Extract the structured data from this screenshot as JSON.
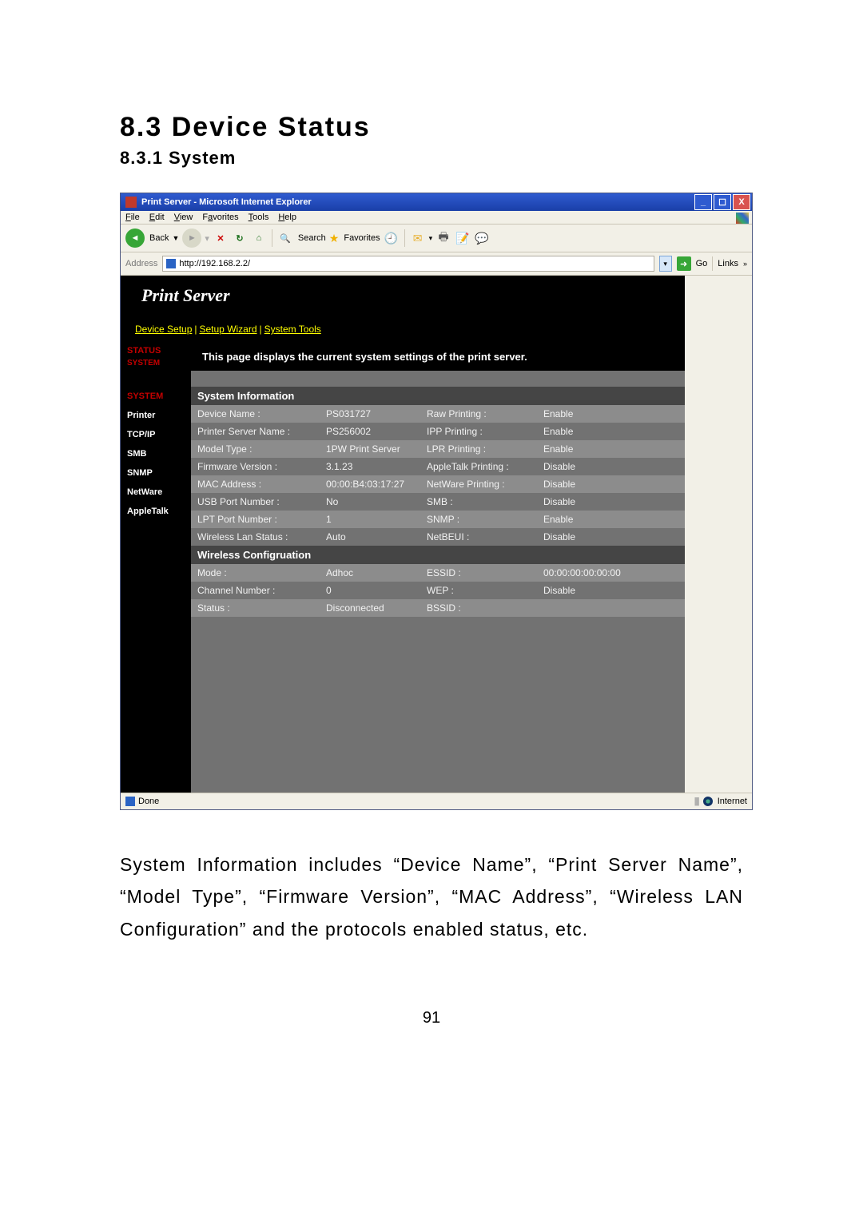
{
  "doc": {
    "h1": "8.3   Device Status",
    "h2": "8.3.1   System",
    "caption": "System Information includes “Device Name”, “Print Server Name”, “Model Type”, “Firmware Version”, “MAC Address”, “Wireless LAN Configuration” and the protocols enabled status, etc.",
    "page_number": "91"
  },
  "browser": {
    "title": "Print Server - Microsoft Internet Explorer",
    "menus": {
      "file": "File",
      "edit": "Edit",
      "view": "View",
      "favorites": "Favorites",
      "tools": "Tools",
      "help": "Help"
    },
    "toolbar": {
      "back": "Back",
      "search": "Search",
      "favorites": "Favorites"
    },
    "address_label": "Address",
    "address_url": "http://192.168.2.2/",
    "go_label": "Go",
    "links_label": "Links",
    "status_done": "Done",
    "status_zone": "Internet"
  },
  "page": {
    "header": "Print Server",
    "nav": {
      "setup": "Device Setup",
      "wizard": "Setup Wizard",
      "tools": "System Tools"
    },
    "sidebar": {
      "status": "STATUS",
      "system_sub": "SYSTEM",
      "items": [
        "SYSTEM",
        "Printer",
        "TCP/IP",
        "SMB",
        "SNMP",
        "NetWare",
        "AppleTalk"
      ]
    },
    "desc": "This page displays the current system settings of the print server.",
    "sections": {
      "sys_info": "System Information",
      "wireless": "Wireless Configruation"
    },
    "sys_rows": [
      {
        "l1": "Device Name :",
        "v1": "PS031727",
        "l2": "Raw Printing :",
        "v2": "Enable"
      },
      {
        "l1": "Printer Server Name :",
        "v1": "PS256002",
        "l2": "IPP Printing :",
        "v2": "Enable"
      },
      {
        "l1": "Model Type :",
        "v1": "1PW Print Server",
        "l2": "LPR Printing :",
        "v2": "Enable"
      },
      {
        "l1": "Firmware Version :",
        "v1": "3.1.23",
        "l2": "AppleTalk Printing :",
        "v2": "Disable"
      },
      {
        "l1": "MAC Address :",
        "v1": "00:00:B4:03:17:27",
        "l2": "NetWare Printing :",
        "v2": "Disable"
      },
      {
        "l1": "USB Port Number :",
        "v1": "No",
        "l2": "SMB :",
        "v2": "Disable"
      },
      {
        "l1": "LPT Port Number :",
        "v1": "1",
        "l2": "SNMP :",
        "v2": "Enable"
      },
      {
        "l1": "Wireless Lan Status :",
        "v1": "Auto",
        "l2": "NetBEUI :",
        "v2": "Disable"
      }
    ],
    "wl_rows": [
      {
        "l1": "Mode :",
        "v1": "Adhoc",
        "l2": "ESSID :",
        "v2": "00:00:00:00:00:00"
      },
      {
        "l1": "Channel Number :",
        "v1": "0",
        "l2": "WEP :",
        "v2": "Disable"
      },
      {
        "l1": "Status :",
        "v1": "Disconnected",
        "l2": "BSSID :",
        "v2": ""
      }
    ]
  }
}
